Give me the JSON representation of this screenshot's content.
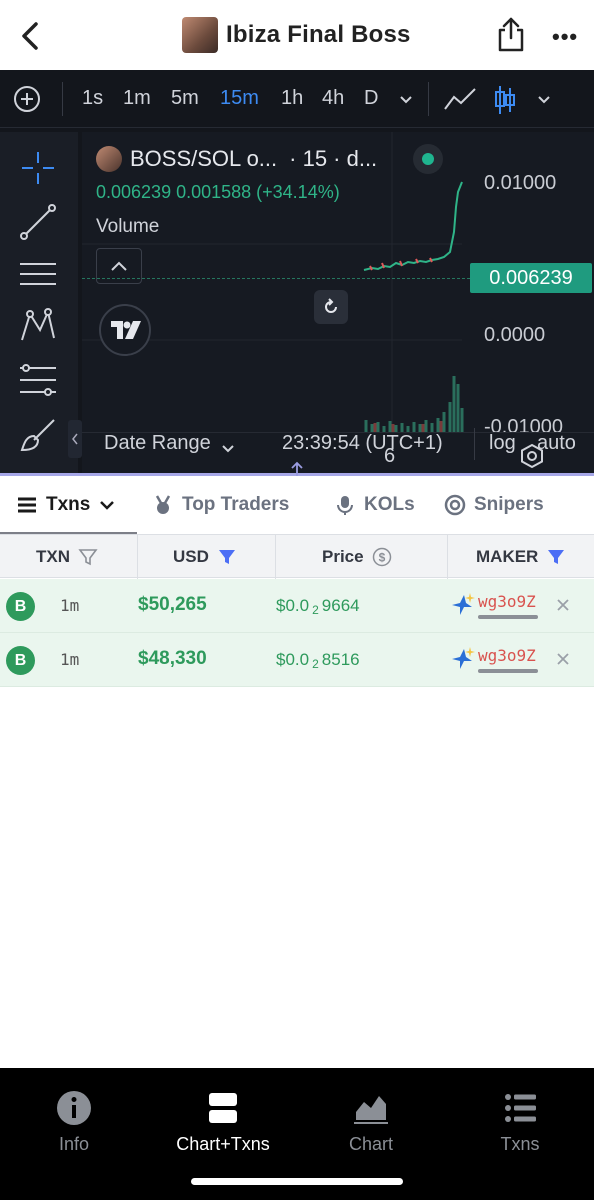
{
  "header": {
    "title": "Ibiza Final Boss"
  },
  "toolbar": {
    "timeframes": [
      "1s",
      "1m",
      "5m",
      "15m",
      "1h",
      "4h",
      "D"
    ],
    "active_timeframe": "15m"
  },
  "chart": {
    "symbol_label": "BOSS/SOL o...",
    "interval_label": "· 15 · d...",
    "ohlc_text": "0.006239  0.001588 (+34.14%)",
    "volume_label": "Volume",
    "price_axis": [
      "0.01000",
      "0.0000",
      "-0.01000"
    ],
    "last_price": "0.006239",
    "time_label": "6",
    "date_range_label": "Date Range",
    "clock": "23:39:54 (UTC+1)",
    "log_label": "log",
    "auto_label": "auto",
    "accent_color": "#1f9b7f"
  },
  "tabs": [
    {
      "label": "Txns",
      "icon": "list-icon"
    },
    {
      "label": "Top Traders",
      "icon": "medal-icon"
    },
    {
      "label": "KOLs",
      "icon": "microphone-icon"
    },
    {
      "label": "Snipers",
      "icon": "target-icon"
    }
  ],
  "table": {
    "columns": [
      "TXN",
      "USD",
      "Price",
      "MAKER"
    ],
    "rows": [
      {
        "type": "B",
        "age": "1m",
        "usd": "$50,265",
        "price_prefix": "$0.0",
        "price_sub": "2",
        "price_rest": "9664",
        "maker": "wg3o9Z"
      },
      {
        "type": "B",
        "age": "1m",
        "usd": "$48,330",
        "price_prefix": "$0.0",
        "price_sub": "2",
        "price_rest": "8516",
        "maker": "wg3o9Z"
      }
    ]
  },
  "nav": [
    {
      "label": "Info",
      "icon": "info-icon"
    },
    {
      "label": "Chart+Txns",
      "icon": "split-view-icon"
    },
    {
      "label": "Chart",
      "icon": "area-chart-icon"
    },
    {
      "label": "Txns",
      "icon": "list-icon"
    }
  ]
}
